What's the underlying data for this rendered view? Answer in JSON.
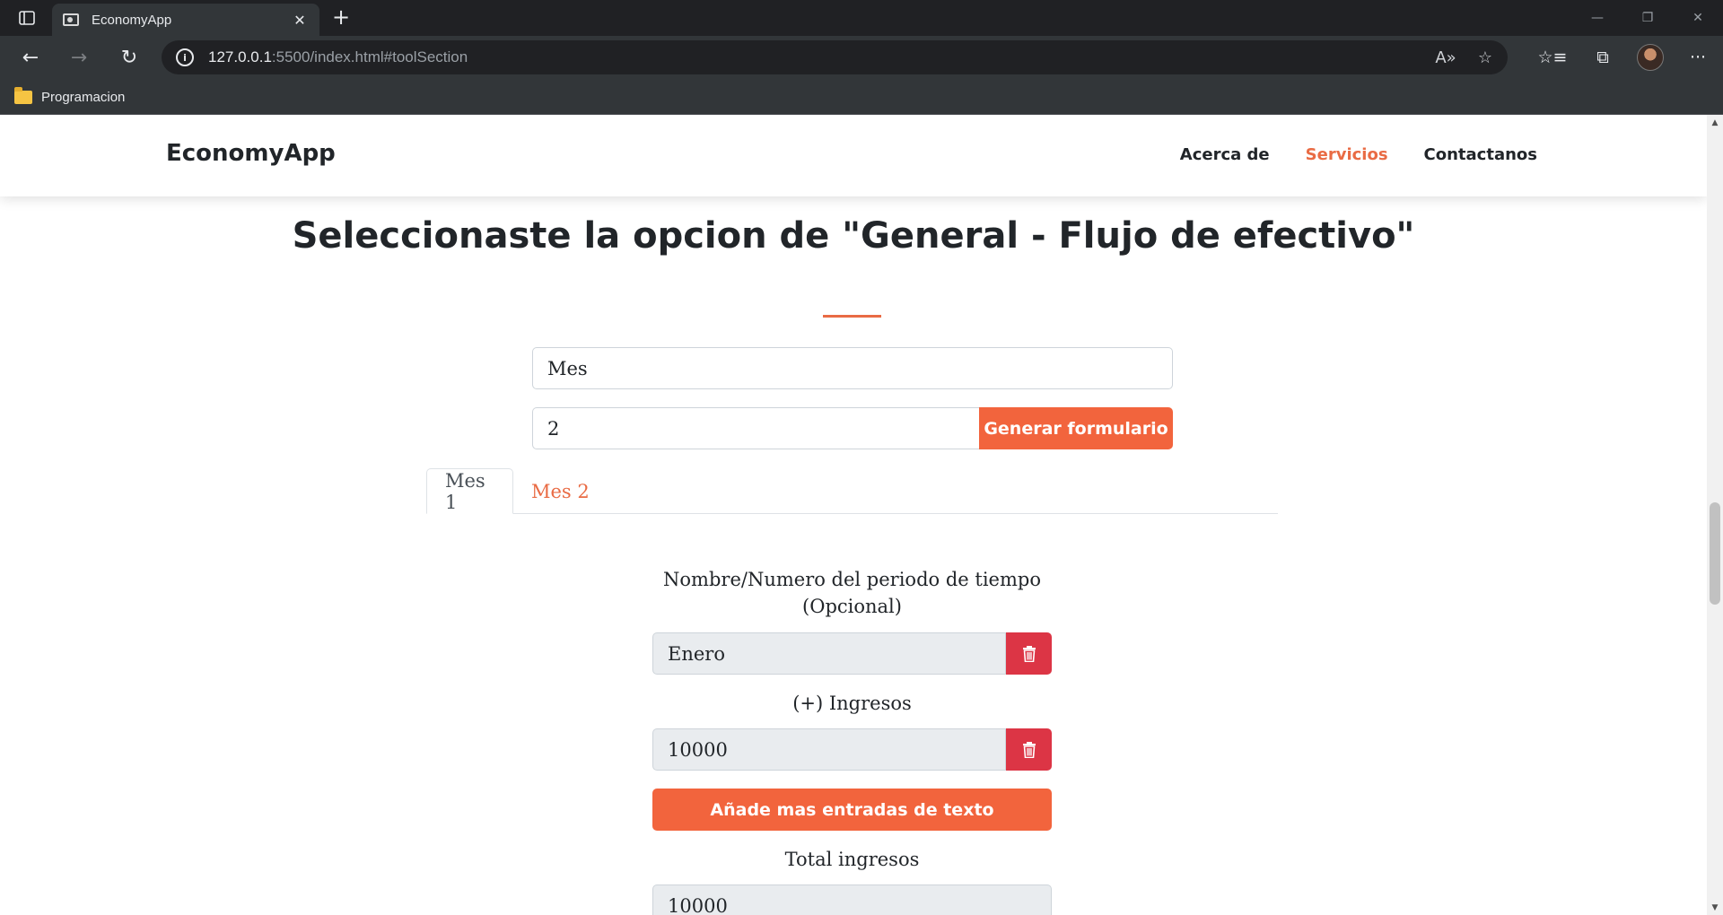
{
  "browser": {
    "tab_title": "EconomyApp",
    "tab_close": "✕",
    "new_tab": "+",
    "url_host": "127.0.0.1",
    "url_rest": ":5500/index.html#toolSection",
    "bookmark_folder": "Programacion",
    "icons": [
      "tab-actions-icon",
      "back-icon",
      "forward-icon",
      "refresh-icon",
      "info-icon",
      "read-aloud-icon",
      "add-favorite-icon",
      "favorites-icon",
      "collections-icon",
      "profile-avatar",
      "more-icon"
    ]
  },
  "site": {
    "logo": "EconomyApp",
    "nav": [
      {
        "label": "Acerca de",
        "active": false
      },
      {
        "label": "Servicios",
        "active": true
      },
      {
        "label": "Contactanos",
        "active": false
      }
    ],
    "accent_color": "#e96b44",
    "button_color": "#f2643d",
    "danger_color": "#dc3545"
  },
  "tool": {
    "title": "Seleccionaste la opcion de \"General - Flujo de efectivo\"",
    "period_type_value": "Mes",
    "period_count_value": "2",
    "generate_button": "Generar formulario",
    "tabs": [
      {
        "label": "Mes 1",
        "active": true
      },
      {
        "label": "Mes 2",
        "active": false
      }
    ],
    "period_name_label": "Nombre/Numero del periodo de tiempo",
    "period_name_optional": "(Opcional)",
    "period_name_value": "Enero",
    "income_label": "(+) Ingresos",
    "income_value": "10000",
    "add_entries_button": "Añade mas entradas de texto",
    "total_income_label": "Total ingresos",
    "total_income_value": "10000"
  }
}
